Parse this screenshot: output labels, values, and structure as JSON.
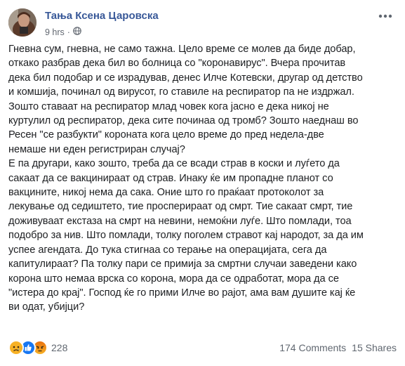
{
  "post": {
    "author": "Тања Ксена Царовска",
    "time": "9 hrs",
    "time_separator": "·",
    "privacy_icon": "globe-icon",
    "more_icon": "more-horizontal-icon",
    "body": "Гневна сум, гневна, не само тажна. Цело време се молев да биде добар,\nоткако разбрав дека бил во болница со \"коронавирус\". Вчера прочитав\nдека бил подобар и се израдував, денес Илче Котевски, другар од детство\nи комшија, починал од вирусот, го ставиле на респиратор па не издржал.\nЗошто ставаат на респиратор млад човек кога јасно е дека никој не\nкуртулил од респиратор, дека сите починаа од тромб? Зошто наеднаш во\nРесен \"се разбукти\" короната кога цело време до пред недела-две\nнемаше ни еден регистриран случај?\nЕ па другари, како зошто, треба да се всади страв в коски и луѓето да\nсакаат да се вакцинираат од страв. Инаку ќе им пропадне планот со\nвакцините, никој нема да сака. Оние што го праќаат протоколот за\nлекување од седиштето, тие просперираат од смрт. Тие сакаат смрт, тие\nдоживуваат екстаза на смрт на невини, немоќни луѓе. Што помлади, тоа\nподобро за нив. Што помлади, толку поголем стравот кај народот, за да им\nуспее агендата. До тука стигнаа со терање на операцијата, сега да\nкапитулираат? Па толку пари се примија за смртни случаи заведени како\nкорона што немаа врска со корона, мора да се одработат, мора да се\n\"истера до крај\". Господ ќе го прими Илче во рајот, ама вам душите кај ќе\nви одат, убијци?"
  },
  "footer": {
    "reaction_icons": [
      "sad-reaction-icon",
      "like-reaction-icon",
      "angry-reaction-icon"
    ],
    "reaction_count": "228",
    "comments": "174 Comments",
    "shares": "15 Shares"
  },
  "colors": {
    "author": "#385898",
    "meta": "#616770",
    "like": "#1877f2",
    "sad": "#f7b125",
    "angry": "#e9710f"
  }
}
